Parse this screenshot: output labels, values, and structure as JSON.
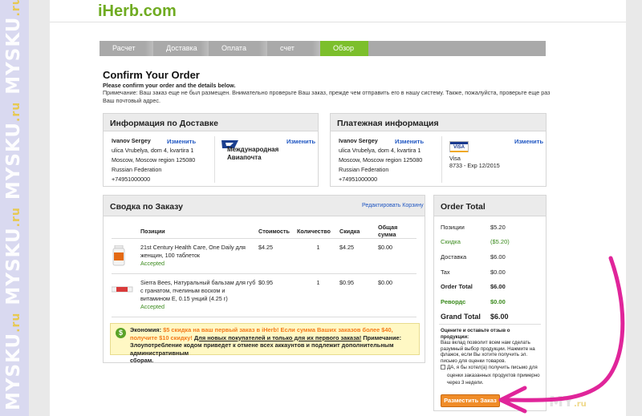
{
  "watermark": {
    "text": "MYSKU",
    "suffix": ".ru",
    "corner_text": "MY"
  },
  "header": {
    "logo": "iHerb.com"
  },
  "steps": [
    {
      "label": "Расчет"
    },
    {
      "label": "Доставка"
    },
    {
      "label": "Оплата"
    },
    {
      "label": "счет"
    },
    {
      "label": "Обзор"
    }
  ],
  "page": {
    "title": "Confirm Your Order",
    "subtitle": "Please confirm your order and the details below.",
    "note_line1": "Примечание: Ваш заказ еще не был размещен. Внимательно проверьте Ваш заказ, прежде чем отправить его в нашу систему. Также, пожалуйста, проверьте еще раз",
    "note_line2": "Ваш почтовый адрес."
  },
  "delivery": {
    "title": "Информация по Доставке",
    "edit_link": "Изменить",
    "carrier_edit_link": "Изменить",
    "carrier_line1": "Международная",
    "carrier_line2": "Авиапочта",
    "address": {
      "name": "Ivanov Sergey",
      "street": "ulica Vrubelya, dom 4, kvartira 1",
      "city": "Moscow, Moscow region 125080",
      "country": "Russian Federation",
      "phone": "+74951000000"
    }
  },
  "payment": {
    "title": "Платежная информация",
    "edit_link": "Изменить",
    "card_edit_link": "Изменить",
    "card_logo": "VISA",
    "card_type": "Visa",
    "card_number": "8733 - Exp 12/2015",
    "address": {
      "name": "Ivanov Sergey",
      "street": "ulica Vrubelya, dom 4, kvartira 1",
      "city": "Moscow, Moscow region 125080",
      "country": "Russian Federation",
      "phone": "+74951000000"
    }
  },
  "summary": {
    "title": "Сводка по Заказу",
    "edit_cart": "Редактировать Корзину",
    "columns": {
      "item": "Позиции",
      "price": "Стоимость",
      "qty": "Количество",
      "discount": "Скидка",
      "total": "Общая сумма"
    },
    "items": [
      {
        "line1": "21st Century Health Care, One Daily для",
        "line2": "женщин, 100 таблеток",
        "line3": "",
        "line4": "",
        "status": "Accepted",
        "price": "$4.25",
        "qty": "1",
        "discount": "$4.25",
        "total": "$0.00"
      },
      {
        "line1": "Sierra Bees, Натуральный бальзам для губ",
        "line2": "с гранатом, пчелиным воском и",
        "line3": "витамином Е, 0.15 унций (4.25 г)",
        "line4": "",
        "status": "Accepted",
        "price": "$0.95",
        "qty": "1",
        "discount": "$0.95",
        "total": "$0.00"
      }
    ],
    "promo": {
      "label": "Экономия:",
      "text1": "$5 скидка на ваш первый заказ в iHerb! Если сумма Ваших заказов более $40,",
      "text2": "получите $10 скидку!",
      "text3": "Для новых покупателей и только для их первого заказа!",
      "text4": "Примечание:",
      "text5": "Злоупотребление кодом приведет к отмене всех аккаунтов и подлежит дополнительным административным",
      "text6": "сборам."
    }
  },
  "order_total": {
    "title": "Order Total",
    "rows": [
      {
        "label": "Позиции",
        "value": "$5.20"
      },
      {
        "label": "Скидка",
        "value": "($5.20)"
      },
      {
        "label": "Доставка",
        "value": "$6.00"
      },
      {
        "label": "Tax",
        "value": "$0.00"
      },
      {
        "label": "Order Total",
        "value": "$6.00"
      },
      {
        "label": "Ревордс",
        "value": "$0.00"
      },
      {
        "label": "Grand Total",
        "value": "$6.00"
      }
    ],
    "review_title1": "Оцените и оставьте отзыв о",
    "review_title2": "продукции:",
    "review_text1": "Ваш вклад позволит всем нам сделать",
    "review_text2": "разумный выбор продукции. Нажмите на",
    "review_text3": "флажок, если Вы хотите получить эл.",
    "review_text4": "письмо для оценки товаров.",
    "checkbox_label1": "ДА, я бы хотел(а) получить письмо для",
    "checkbox_label2": "оценки заказанных продуктов примерно",
    "checkbox_label3": "через 3 недели.",
    "place_order": "Разместить Заказ"
  },
  "colors": {
    "brand_green": "#6fab21",
    "step_active": "#7cbf2c",
    "button_orange": "#f08c28",
    "arrow_magenta": "#e0259a",
    "link_blue": "#1f56c2"
  }
}
